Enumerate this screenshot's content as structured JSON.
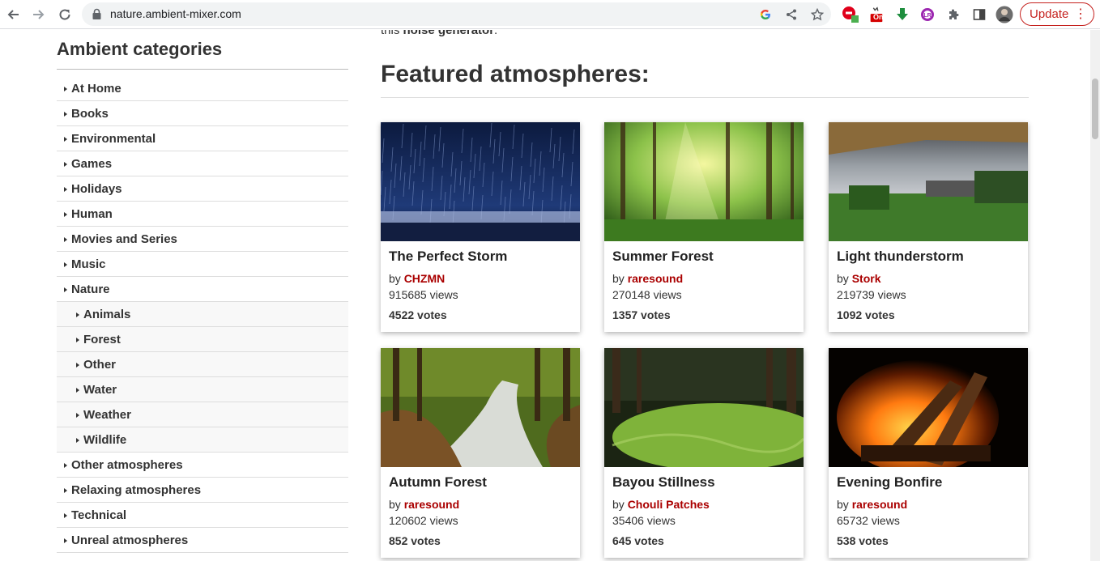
{
  "browser": {
    "url": "nature.ambient-mixer.com",
    "update_label": "Update",
    "extension_badge": "On"
  },
  "page": {
    "intro_prefix": "this ",
    "intro_bold": "noise generator",
    "intro_suffix": ".",
    "sidebar_title": "Ambient categories",
    "featured_title": "Featured atmospheres:",
    "by_label": "by"
  },
  "categories": [
    {
      "label": "At Home",
      "sub": false
    },
    {
      "label": "Books",
      "sub": false
    },
    {
      "label": "Environmental",
      "sub": false
    },
    {
      "label": "Games",
      "sub": false
    },
    {
      "label": "Holidays",
      "sub": false
    },
    {
      "label": "Human",
      "sub": false
    },
    {
      "label": "Movies and Series",
      "sub": false
    },
    {
      "label": "Music",
      "sub": false
    },
    {
      "label": "Nature",
      "sub": false
    },
    {
      "label": "Animals",
      "sub": true
    },
    {
      "label": "Forest",
      "sub": true
    },
    {
      "label": "Other",
      "sub": true
    },
    {
      "label": "Water",
      "sub": true
    },
    {
      "label": "Weather",
      "sub": true
    },
    {
      "label": "Wildlife",
      "sub": true
    },
    {
      "label": "Other atmospheres",
      "sub": false
    },
    {
      "label": "Relaxing atmospheres",
      "sub": false
    },
    {
      "label": "Technical",
      "sub": false
    },
    {
      "label": "Unreal atmospheres",
      "sub": false
    }
  ],
  "cards": [
    {
      "title": "The Perfect Storm",
      "author": "CHZMN",
      "views": "915685 views",
      "votes": "4522 votes"
    },
    {
      "title": "Summer Forest",
      "author": "raresound",
      "views": "270148 views",
      "votes": "1357 votes"
    },
    {
      "title": "Light thunderstorm",
      "author": "Stork",
      "views": "219739 views",
      "votes": "1092 votes"
    },
    {
      "title": "Autumn Forest",
      "author": "raresound",
      "views": "120602 views",
      "votes": "852 votes"
    },
    {
      "title": "Bayou Stillness",
      "author": "Chouli Patches",
      "views": "35406 views",
      "votes": "645 votes"
    },
    {
      "title": "Evening Bonfire",
      "author": "raresound",
      "views": "65732 views",
      "votes": "538 votes"
    }
  ]
}
